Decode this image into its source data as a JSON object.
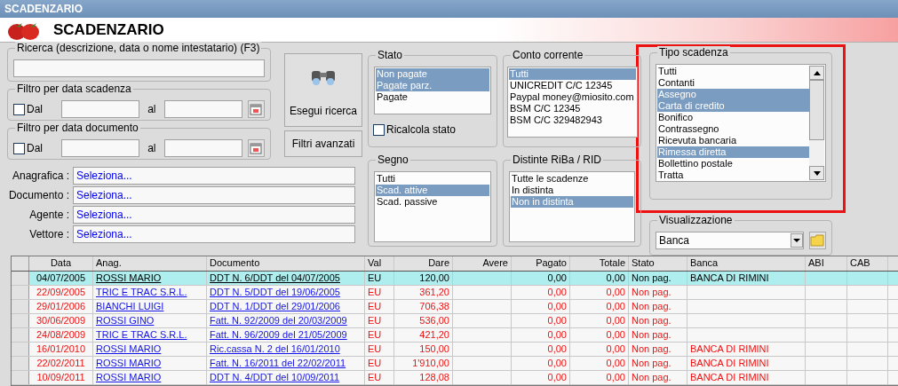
{
  "window": {
    "title": "SCADENZARIO"
  },
  "header": {
    "title": "SCADENZARIO"
  },
  "search": {
    "label": "Ricerca (descrizione, data o nome intestatario) (F3)"
  },
  "date_filters": [
    {
      "label": "Filtro per data scadenza",
      "check_label": "Dal",
      "checked": false,
      "to_label": "al"
    },
    {
      "label": "Filtro per data documento",
      "check_label": "Dal",
      "checked": false,
      "to_label": "al"
    }
  ],
  "buttons": [
    {
      "kind": "search",
      "label": "Esegui ricerca"
    },
    {
      "kind": "plain",
      "label": "Filtri avanzati"
    }
  ],
  "lookups": [
    {
      "label": "Anagrafica :",
      "value": "Seleziona..."
    },
    {
      "label": "Documento :",
      "value": "Seleziona..."
    },
    {
      "label": "Agente :",
      "value": "Seleziona..."
    },
    {
      "label": "Vettore :",
      "value": "Seleziona..."
    }
  ],
  "stato": {
    "label": "Stato",
    "items": [
      {
        "text": "Non pagate",
        "selected": true
      },
      {
        "text": "Pagate parz.",
        "selected": true
      },
      {
        "text": "Pagate",
        "selected": false
      }
    ],
    "recalc": {
      "label": "Ricalcola stato",
      "checked": false
    }
  },
  "conto_corrente": {
    "label": "Conto corrente",
    "items": [
      {
        "text": "Tutti",
        "selected": true
      },
      {
        "text": "UNICREDIT C/C 12345",
        "selected": false
      },
      {
        "text": "Paypal money@miosito.com",
        "selected": false
      },
      {
        "text": "BSM C/C 12345",
        "selected": false
      },
      {
        "text": "BSM C/C 329482943",
        "selected": false
      }
    ]
  },
  "segno": {
    "label": "Segno",
    "items": [
      {
        "text": "Tutti",
        "selected": false
      },
      {
        "text": "Scad. attive",
        "selected": true
      },
      {
        "text": "Scad. passive",
        "selected": false
      }
    ]
  },
  "distinte": {
    "label": "Distinte RiBa / RID",
    "items": [
      {
        "text": "Tutte le scadenze",
        "selected": false
      },
      {
        "text": "In distinta",
        "selected": false
      },
      {
        "text": "Non in distinta",
        "selected": true
      }
    ]
  },
  "tipo_scadenza": {
    "label": "Tipo scadenza",
    "items": [
      {
        "text": "Tutti",
        "selected": false
      },
      {
        "text": "Contanti",
        "selected": false
      },
      {
        "text": "Assegno",
        "selected": true
      },
      {
        "text": "Carta di credito",
        "selected": true
      },
      {
        "text": "Bonifico",
        "selected": false
      },
      {
        "text": "Contrassegno",
        "selected": false
      },
      {
        "text": "Ricevuta bancaria",
        "selected": false
      },
      {
        "text": "Rimessa diretta",
        "selected": true
      },
      {
        "text": "Bollettino postale",
        "selected": false
      },
      {
        "text": "Tratta",
        "selected": false
      }
    ]
  },
  "visualizzazione": {
    "label": "Visualizzazione",
    "value": "Banca"
  },
  "table": {
    "columns": [
      "Data",
      "Anag.",
      "Documento",
      "Val",
      "Dare",
      "Avere",
      "Pagato",
      "Totale",
      "Stato",
      "Banca",
      "ABI",
      "CAB"
    ],
    "rows": [
      {
        "selected": true,
        "overdue": false,
        "cells": [
          "04/07/2005",
          "ROSSI MARIO",
          "DDT N. 6/DDT del 04/07/2005",
          "EU",
          "120,00",
          null,
          "0,00",
          "0,00",
          "Non pag.",
          "BANCA DI RIMINI",
          null,
          null
        ]
      },
      {
        "selected": false,
        "overdue": true,
        "cells": [
          "22/09/2005",
          "TRIC E TRAC S.R.L.",
          "DDT N. 5/DDT del 19/06/2005",
          "EU",
          "361,20",
          null,
          "0,00",
          "0,00",
          "Non pag.",
          null,
          null,
          null
        ]
      },
      {
        "selected": false,
        "overdue": true,
        "cells": [
          "29/01/2006",
          "BIANCHI LUIGI",
          "DDT N. 1/DDT del 29/01/2006",
          "EU",
          "706,38",
          null,
          "0,00",
          "0,00",
          "Non pag.",
          null,
          null,
          null
        ]
      },
      {
        "selected": false,
        "overdue": true,
        "cells": [
          "30/06/2009",
          "ROSSI GINO",
          "Fatt. N. 92/2009 del 20/03/2009",
          "EU",
          "536,00",
          null,
          "0,00",
          "0,00",
          "Non pag.",
          null,
          null,
          null
        ]
      },
      {
        "selected": false,
        "overdue": true,
        "cells": [
          "24/08/2009",
          "TRIC E TRAC S.R.L.",
          "Fatt. N. 96/2009 del 21/05/2009",
          "EU",
          "421,20",
          null,
          "0,00",
          "0,00",
          "Non pag.",
          null,
          null,
          null
        ]
      },
      {
        "selected": false,
        "overdue": true,
        "cells": [
          "16/01/2010",
          "ROSSI MARIO",
          "Ric.cassa N. 2 del 16/01/2010",
          "EU",
          "150,00",
          null,
          "0,00",
          "0,00",
          "Non pag.",
          "BANCA DI RIMINI",
          null,
          null
        ]
      },
      {
        "selected": false,
        "overdue": true,
        "cells": [
          "22/02/2011",
          "ROSSI MARIO",
          "Fatt. N. 16/2011 del 22/02/2011",
          "EU",
          "1'910,00",
          null,
          "0,00",
          "0,00",
          "Non pag.",
          "BANCA DI RIMINI",
          null,
          null
        ]
      },
      {
        "selected": false,
        "overdue": true,
        "cells": [
          "10/09/2011",
          "ROSSI MARIO",
          "DDT N. 4/DDT del 10/09/2011",
          "EU",
          "128,08",
          null,
          "0,00",
          "0,00",
          "Non pag.",
          "BANCA DI RIMINI",
          null,
          null
        ]
      }
    ]
  }
}
